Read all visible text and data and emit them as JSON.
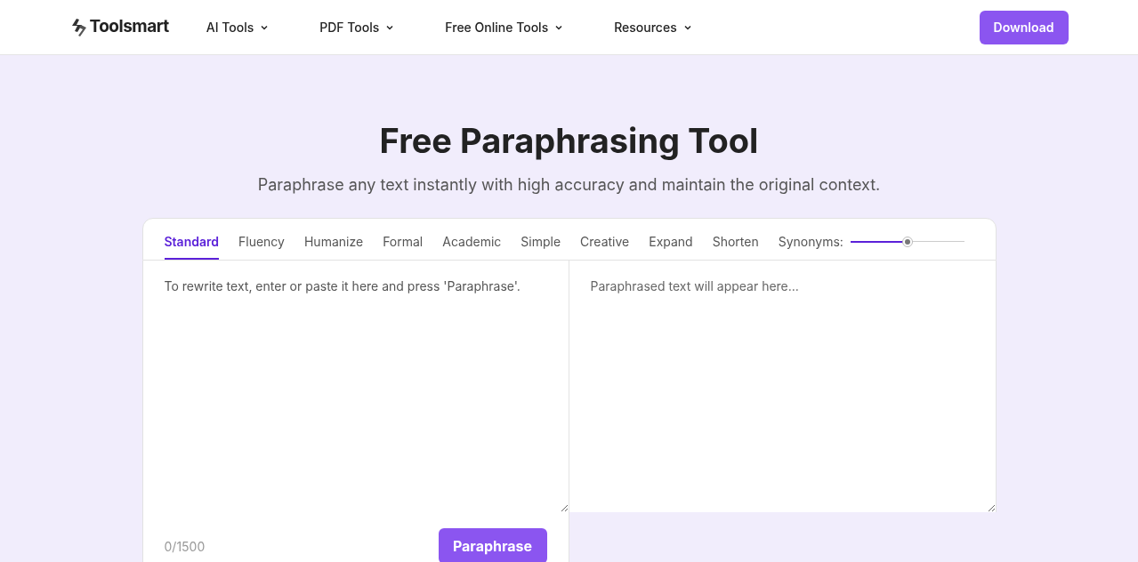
{
  "header": {
    "logo": "Toolsmart",
    "nav": [
      {
        "label": "AI Tools"
      },
      {
        "label": "PDF Tools"
      },
      {
        "label": "Free Online Tools"
      },
      {
        "label": "Resources"
      }
    ],
    "download": "Download"
  },
  "hero": {
    "title": "Free Paraphrasing Tool",
    "subtitle": "Paraphrase any text instantly with high accuracy and maintain the original context."
  },
  "modes": [
    {
      "label": "Standard",
      "selected": true
    },
    {
      "label": "Fluency",
      "selected": false
    },
    {
      "label": "Humanize",
      "selected": false
    },
    {
      "label": "Formal",
      "selected": false
    },
    {
      "label": "Academic",
      "selected": false
    },
    {
      "label": "Simple",
      "selected": false
    },
    {
      "label": "Creative",
      "selected": false
    },
    {
      "label": "Expand",
      "selected": false
    },
    {
      "label": "Shorten",
      "selected": false
    }
  ],
  "synonyms": {
    "label": "Synonyms:",
    "level": 0.5
  },
  "input": {
    "placeholder": "To rewrite text, enter or paste it here and press 'Paraphrase'.",
    "counter": "0/1500",
    "button": "Paraphrase"
  },
  "output": {
    "placeholder": "Paraphrased text will appear here..."
  }
}
